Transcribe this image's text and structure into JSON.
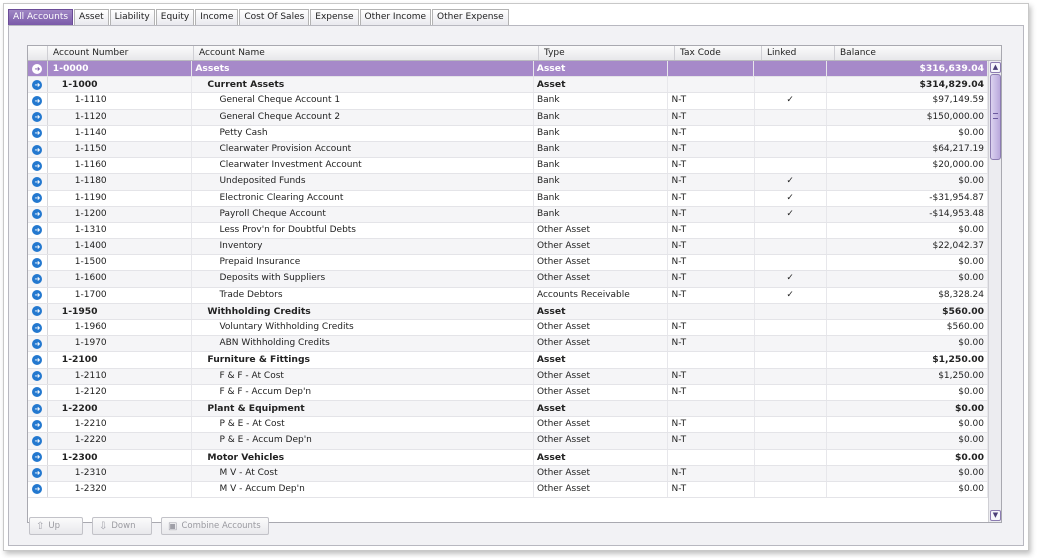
{
  "tabs": [
    {
      "label": "All Accounts",
      "active": true
    },
    {
      "label": "Asset"
    },
    {
      "label": "Liability"
    },
    {
      "label": "Equity"
    },
    {
      "label": "Income"
    },
    {
      "label": "Cost Of Sales"
    },
    {
      "label": "Expense"
    },
    {
      "label": "Other Income"
    },
    {
      "label": "Other Expense"
    }
  ],
  "columns": {
    "number": "Account Number",
    "name": "Account Name",
    "type": "Type",
    "tax": "Tax Code",
    "linked": "Linked",
    "balance": "Balance"
  },
  "rows": [
    {
      "number": "1-0000",
      "name": "Assets",
      "type": "Asset",
      "tax": "",
      "linked": "",
      "balance": "$316,639.04",
      "level": 0,
      "header": true,
      "selected": true
    },
    {
      "number": "1-1000",
      "name": "Current Assets",
      "type": "Asset",
      "tax": "",
      "linked": "",
      "balance": "$314,829.04",
      "level": 1,
      "header": true
    },
    {
      "number": "1-1110",
      "name": "General Cheque Account 1",
      "type": "Bank",
      "tax": "N-T",
      "linked": "✓",
      "balance": "$97,149.59",
      "level": 2
    },
    {
      "number": "1-1120",
      "name": "General Cheque Account 2",
      "type": "Bank",
      "tax": "N-T",
      "linked": "",
      "balance": "$150,000.00",
      "level": 2
    },
    {
      "number": "1-1140",
      "name": "Petty Cash",
      "type": "Bank",
      "tax": "N-T",
      "linked": "",
      "balance": "$0.00",
      "level": 2
    },
    {
      "number": "1-1150",
      "name": "Clearwater Provision Account",
      "type": "Bank",
      "tax": "N-T",
      "linked": "",
      "balance": "$64,217.19",
      "level": 2
    },
    {
      "number": "1-1160",
      "name": "Clearwater Investment Account",
      "type": "Bank",
      "tax": "N-T",
      "linked": "",
      "balance": "$20,000.00",
      "level": 2
    },
    {
      "number": "1-1180",
      "name": "Undeposited Funds",
      "type": "Bank",
      "tax": "N-T",
      "linked": "✓",
      "balance": "$0.00",
      "level": 2
    },
    {
      "number": "1-1190",
      "name": "Electronic Clearing Account",
      "type": "Bank",
      "tax": "N-T",
      "linked": "✓",
      "balance": "-$31,954.87",
      "level": 2
    },
    {
      "number": "1-1200",
      "name": "Payroll Cheque Account",
      "type": "Bank",
      "tax": "N-T",
      "linked": "✓",
      "balance": "-$14,953.48",
      "level": 2
    },
    {
      "number": "1-1310",
      "name": "Less Prov'n for Doubtful Debts",
      "type": "Other Asset",
      "tax": "N-T",
      "linked": "",
      "balance": "$0.00",
      "level": 2
    },
    {
      "number": "1-1400",
      "name": "Inventory",
      "type": "Other Asset",
      "tax": "N-T",
      "linked": "",
      "balance": "$22,042.37",
      "level": 2
    },
    {
      "number": "1-1500",
      "name": "Prepaid Insurance",
      "type": "Other Asset",
      "tax": "N-T",
      "linked": "",
      "balance": "$0.00",
      "level": 2
    },
    {
      "number": "1-1600",
      "name": "Deposits with Suppliers",
      "type": "Other Asset",
      "tax": "N-T",
      "linked": "✓",
      "balance": "$0.00",
      "level": 2
    },
    {
      "number": "1-1700",
      "name": "Trade Debtors",
      "type": "Accounts Receivable",
      "tax": "N-T",
      "linked": "✓",
      "balance": "$8,328.24",
      "level": 2
    },
    {
      "number": "1-1950",
      "name": "Withholding Credits",
      "type": "Asset",
      "tax": "",
      "linked": "",
      "balance": "$560.00",
      "level": 1,
      "header": true
    },
    {
      "number": "1-1960",
      "name": "Voluntary Withholding Credits",
      "type": "Other Asset",
      "tax": "N-T",
      "linked": "",
      "balance": "$560.00",
      "level": 2
    },
    {
      "number": "1-1970",
      "name": "ABN Withholding Credits",
      "type": "Other Asset",
      "tax": "N-T",
      "linked": "",
      "balance": "$0.00",
      "level": 2
    },
    {
      "number": "1-2100",
      "name": "Furniture & Fittings",
      "type": "Asset",
      "tax": "",
      "linked": "",
      "balance": "$1,250.00",
      "level": 1,
      "header": true
    },
    {
      "number": "1-2110",
      "name": "F & F  - At Cost",
      "type": "Other Asset",
      "tax": "N-T",
      "linked": "",
      "balance": "$1,250.00",
      "level": 2
    },
    {
      "number": "1-2120",
      "name": "F & F - Accum  Dep'n",
      "type": "Other Asset",
      "tax": "N-T",
      "linked": "",
      "balance": "$0.00",
      "level": 2
    },
    {
      "number": "1-2200",
      "name": "Plant & Equipment",
      "type": "Asset",
      "tax": "",
      "linked": "",
      "balance": "$0.00",
      "level": 1,
      "header": true
    },
    {
      "number": "1-2210",
      "name": "P & E - At Cost",
      "type": "Other Asset",
      "tax": "N-T",
      "linked": "",
      "balance": "$0.00",
      "level": 2
    },
    {
      "number": "1-2220",
      "name": "P & E - Accum Dep'n",
      "type": "Other Asset",
      "tax": "N-T",
      "linked": "",
      "balance": "$0.00",
      "level": 2
    },
    {
      "number": "1-2300",
      "name": "Motor Vehicles",
      "type": "Asset",
      "tax": "",
      "linked": "",
      "balance": "$0.00",
      "level": 1,
      "header": true
    },
    {
      "number": "1-2310",
      "name": "M V - At Cost",
      "type": "Other Asset",
      "tax": "N-T",
      "linked": "",
      "balance": "$0.00",
      "level": 2
    },
    {
      "number": "1-2320",
      "name": "M V - Accum Dep'n",
      "type": "Other Asset",
      "tax": "N-T",
      "linked": "",
      "balance": "$0.00",
      "level": 2
    }
  ],
  "buttons": {
    "up": "Up",
    "down": "Down",
    "combine": "Combine Accounts"
  },
  "colors": {
    "accent": "#7a5aa9",
    "selection": "#a689c9",
    "row_icon": "#2378cf"
  }
}
